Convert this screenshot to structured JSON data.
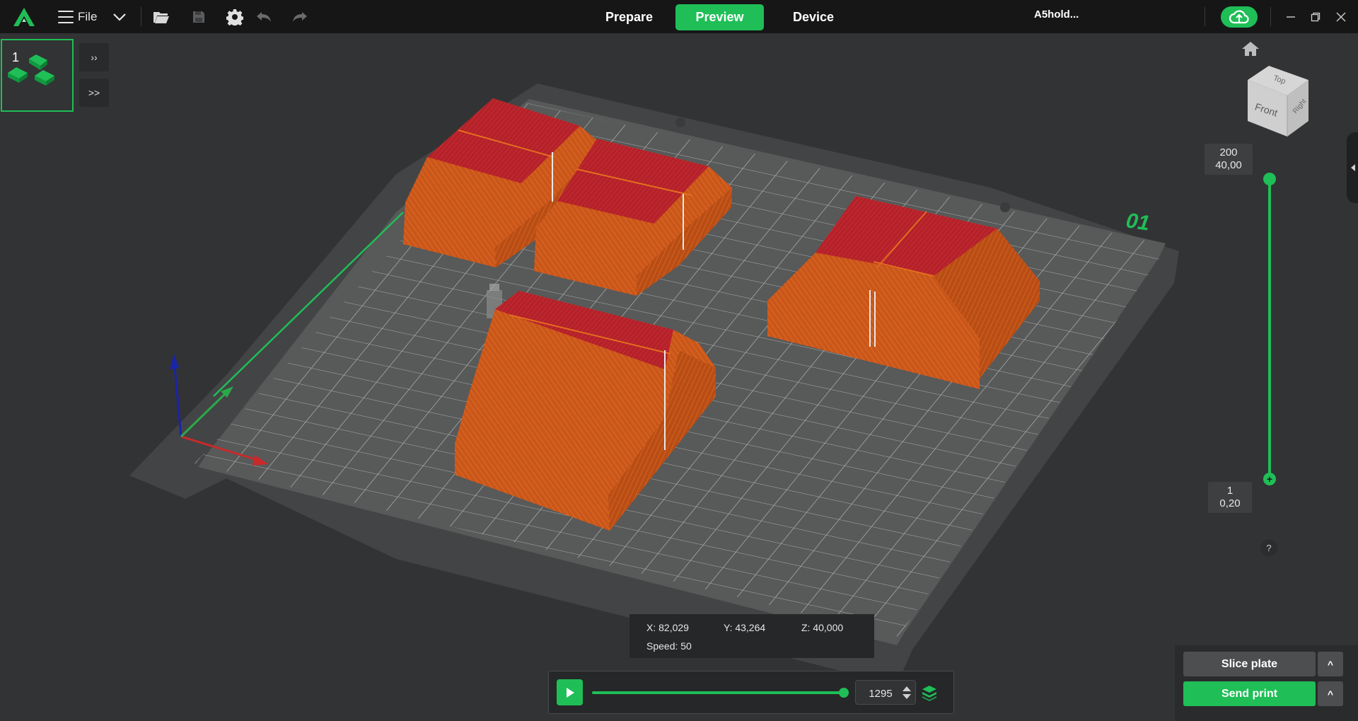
{
  "topbar": {
    "file_label": "File",
    "tabs": [
      "Prepare",
      "Preview",
      "Device"
    ],
    "active_tab": "Preview",
    "account_label": "A5hold..."
  },
  "plate": {
    "thumb_number": "1",
    "expand_top_label": "››",
    "expand_bottom_label": ">>",
    "plate_marking": "01"
  },
  "view_cube": {
    "top": "Top",
    "front": "Front",
    "right": "Right"
  },
  "layer_slider": {
    "top_layer": "200",
    "top_height": "40,00",
    "bottom_layer": "1",
    "bottom_height": "0,20",
    "help_label": "?"
  },
  "coords": {
    "x": "X: 82,029",
    "y": "Y: 43,264",
    "z": "Z: 40,000",
    "speed": "Speed: 50"
  },
  "playback": {
    "move_value": "1295",
    "progress": 1.0
  },
  "actions": {
    "slice_label": "Slice plate",
    "send_label": "Send print",
    "caret_label": "^"
  },
  "colors": {
    "accent": "#1fbe57",
    "model_orange": "#cc5a1a",
    "model_red": "#b8232a",
    "bed": "#555657"
  }
}
